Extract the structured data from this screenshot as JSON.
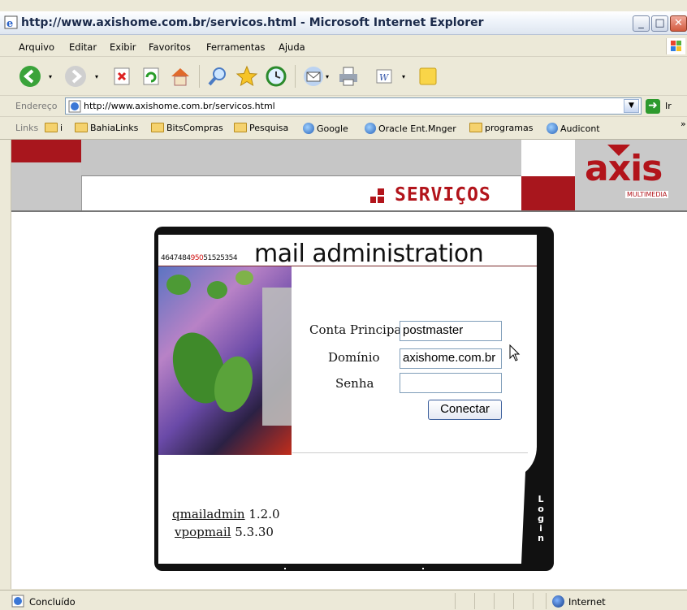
{
  "window": {
    "title": "http://www.axishome.com.br/servicos.html - Microsoft Internet Explorer",
    "buttons": [
      "minimize",
      "maximize",
      "close"
    ]
  },
  "menu": {
    "items": [
      "Arquivo",
      "Editar",
      "Exibir",
      "Favoritos",
      "Ferramentas",
      "Ajuda"
    ]
  },
  "address": {
    "label": "Endereço",
    "url": "http://www.axishome.com.br/servicos.html",
    "go_label": "Ir"
  },
  "links": {
    "label": "Links",
    "items": [
      {
        "label": "i",
        "icon": "folder-icon"
      },
      {
        "label": "BahiaLinks",
        "icon": "folder-icon"
      },
      {
        "label": "BitsCompras",
        "icon": "folder-icon"
      },
      {
        "label": "Pesquisa",
        "icon": "folder-icon"
      },
      {
        "label": "Google",
        "icon": "ie-page-icon"
      },
      {
        "label": "Oracle Ent.Mnger",
        "icon": "ie-page-icon"
      },
      {
        "label": "programas",
        "icon": "folder-icon"
      },
      {
        "label": "Audicont",
        "icon": "ie-page-icon"
      }
    ]
  },
  "site": {
    "section_title": "SERVIÇOS",
    "logo_text": "axis",
    "logo_subtitle": "MULTIMEDIA",
    "brand_color": "#b2141b"
  },
  "mail": {
    "numbers_black": "4647484",
    "numbers_red": "950",
    "numbers_tail": "51525354",
    "title": "mail administration",
    "form": {
      "conta_label": "Conta Principal",
      "conta_value": "postmaster",
      "dominio_label": "Domínio",
      "dominio_value": "axishome.com.br",
      "senha_label": "Senha",
      "senha_value": "",
      "submit_label": "Conectar"
    },
    "versions": [
      {
        "name": "qmailadmin",
        "version": "1.2.0"
      },
      {
        "name": "vpopmail",
        "version": "5.3.30"
      }
    ],
    "side_tab": "Login"
  },
  "status": {
    "text": "Concluído",
    "zone": "Internet"
  }
}
